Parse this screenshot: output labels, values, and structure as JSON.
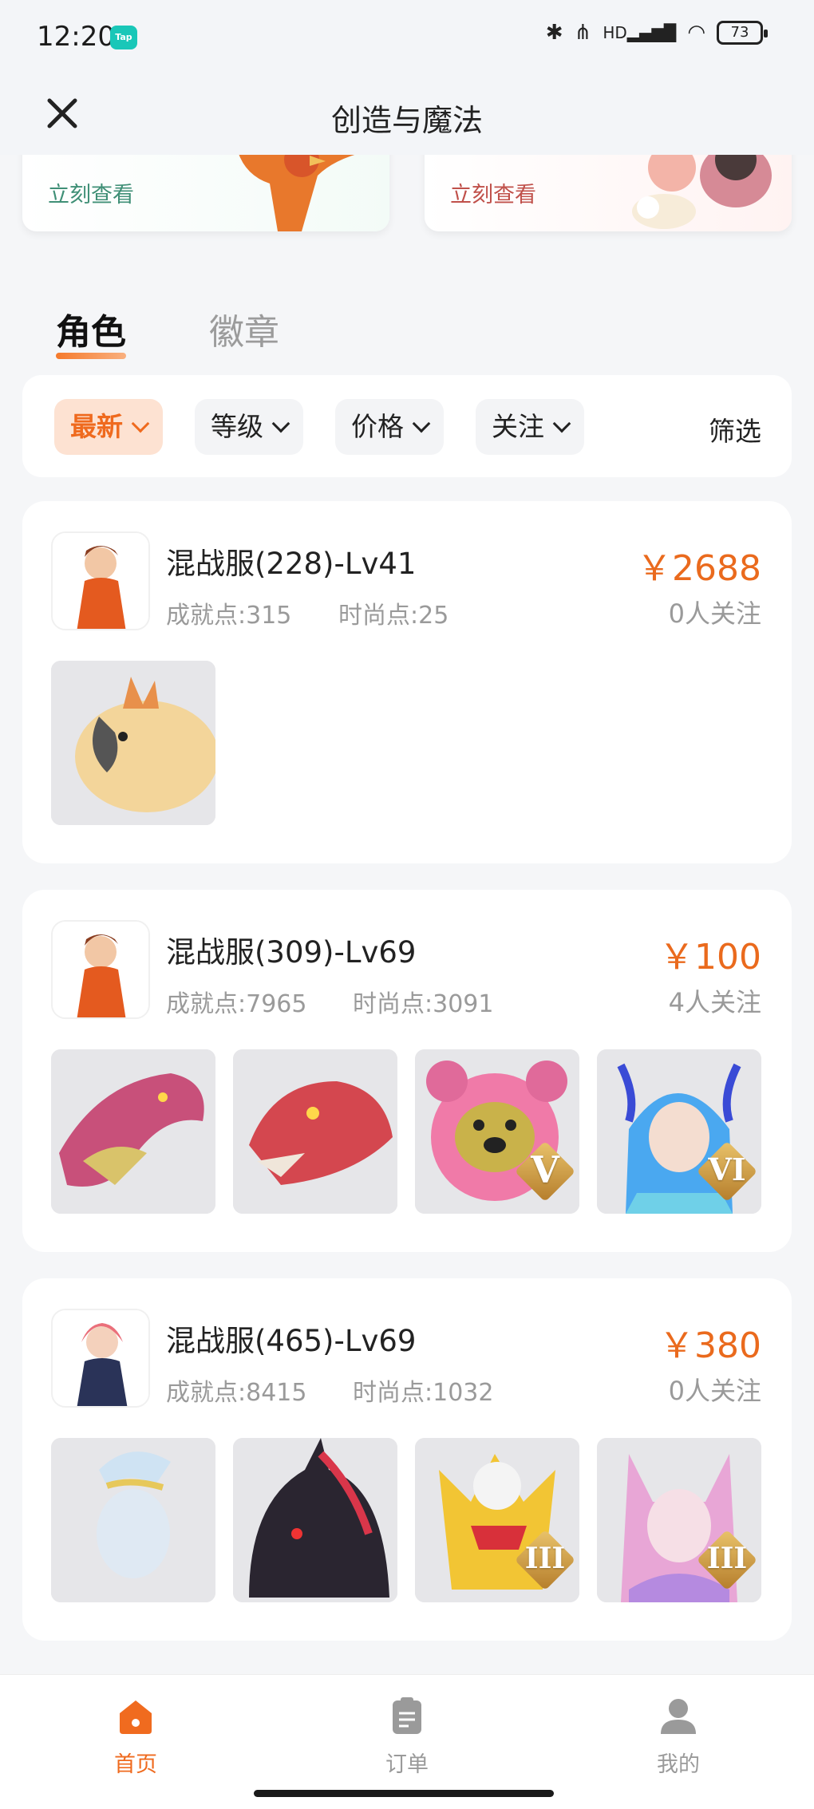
{
  "status_bar": {
    "time": "12:20",
    "tap_badge": "Tap",
    "battery": "73",
    "hd": "HD"
  },
  "nav": {
    "title": "创造与魔法"
  },
  "banners": [
    {
      "link": "立刻查看",
      "art_icon": "phoenix-bird-icon"
    },
    {
      "link": "立刻查看",
      "art_icon": "cute-creatures-icon"
    }
  ],
  "tabs": [
    {
      "label": "角色",
      "active": true
    },
    {
      "label": "徽章",
      "active": false
    }
  ],
  "filters": {
    "chips": [
      {
        "label": "最新",
        "active": true
      },
      {
        "label": "等级"
      },
      {
        "label": "价格"
      },
      {
        "label": "关注"
      }
    ],
    "screen": "筛选"
  },
  "listings": [
    {
      "name": "混战服(228)-Lv41",
      "achievement": "成就点:315",
      "fashion": "时尚点:25",
      "price": "￥2688",
      "follows": "0人关注",
      "items": [
        {
          "icon": "cockatoo-mount",
          "badge": ""
        }
      ]
    },
    {
      "name": "混战服(309)-Lv69",
      "achievement": "成就点:7965",
      "fashion": "时尚点:3091",
      "price": "￥100",
      "follows": "4人关注",
      "items": [
        {
          "icon": "dragon-mount",
          "badge": ""
        },
        {
          "icon": "red-dragon-mount",
          "badge": ""
        },
        {
          "icon": "pink-bear-pet",
          "badge": "V"
        },
        {
          "icon": "blue-dragon-girl",
          "badge": "VI"
        }
      ]
    },
    {
      "name": "混战服(465)-Lv69",
      "achievement": "成就点:8415",
      "fashion": "时尚点:1032",
      "price": "￥380",
      "follows": "0人关注",
      "items": [
        {
          "icon": "white-fairy",
          "badge": ""
        },
        {
          "icon": "black-dragon-mount",
          "badge": ""
        },
        {
          "icon": "golden-armor",
          "badge": "III"
        },
        {
          "icon": "fox-fairy",
          "badge": "III"
        }
      ]
    }
  ],
  "bottom_nav": [
    {
      "label": "首页",
      "active": true
    },
    {
      "label": "订单"
    },
    {
      "label": "我的"
    }
  ],
  "colors": {
    "accent": "#ef6a1e",
    "price": "#ea6a1d",
    "muted": "#9a9a9a"
  }
}
